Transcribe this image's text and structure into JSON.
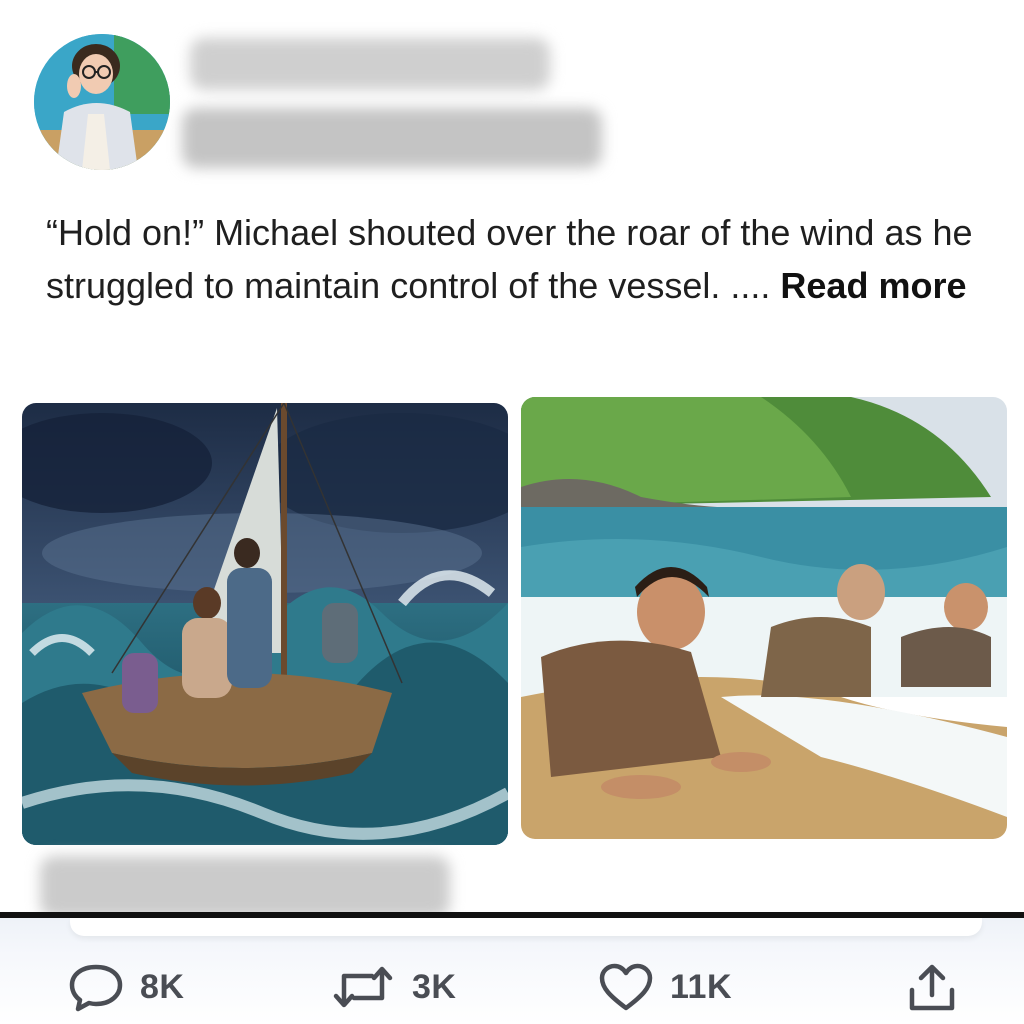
{
  "post": {
    "quote_open": "“Hold on!”",
    "story_text": " Michael shouted over the roar of the wind as he struggled to maintain control of the vessel.  ....",
    "read_more": "Read more"
  },
  "images": [
    {
      "subject": "family on sailboat in storm"
    },
    {
      "subject": "survivors crawling onto beach"
    }
  ],
  "actions": {
    "reply": {
      "icon": "speech-bubble-icon",
      "count": "8K"
    },
    "repost": {
      "icon": "repost-icon",
      "count": "3K"
    },
    "like": {
      "icon": "heart-icon",
      "count": "11K"
    },
    "share": {
      "icon": "share-icon"
    }
  },
  "colors": {
    "icon": "#4a4d54",
    "text": "#1f1f1f"
  }
}
